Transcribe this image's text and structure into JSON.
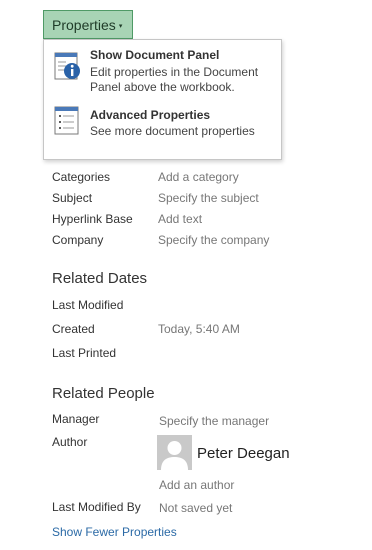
{
  "properties_button": {
    "label": "Properties",
    "caret": "▾"
  },
  "menu": {
    "items": [
      {
        "title": "Show Document Panel",
        "desc": "Edit properties in the Document Panel above the workbook.",
        "icon": "document-panel-icon"
      },
      {
        "title": "Advanced Properties",
        "desc": "See more document properties",
        "icon": "advanced-properties-icon"
      }
    ]
  },
  "fields": [
    {
      "label": "Categories",
      "value": "Add a category"
    },
    {
      "label": "Subject",
      "value": "Specify the subject"
    },
    {
      "label": "Hyperlink Base",
      "value": "Add text"
    },
    {
      "label": "Company",
      "value": "Specify the company"
    }
  ],
  "related_dates": {
    "heading": "Related Dates",
    "last_modified": {
      "label": "Last Modified",
      "value": ""
    },
    "created": {
      "label": "Created",
      "value": "Today, 5:40 AM"
    },
    "last_printed": {
      "label": "Last Printed",
      "value": ""
    }
  },
  "related_people": {
    "heading": "Related People",
    "manager": {
      "label": "Manager",
      "value": "Specify the manager"
    },
    "author": {
      "label": "Author",
      "name": "Peter Deegan",
      "add": "Add an author"
    },
    "last_modified_by": {
      "label": "Last Modified By",
      "value": "Not saved yet"
    }
  },
  "show_fewer": "Show Fewer Properties"
}
